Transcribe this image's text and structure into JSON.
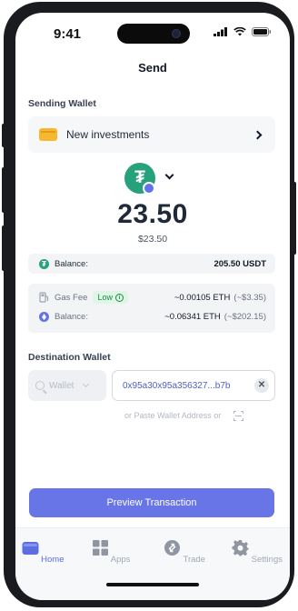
{
  "status_bar": {
    "time": "9:41"
  },
  "header": {
    "title": "Send"
  },
  "sending_wallet": {
    "section_label": "Sending Wallet",
    "wallet_name": "New investments"
  },
  "token": {
    "amount": "23.50",
    "amount_usd": "$23.50",
    "balance_label": "Balance:",
    "balance_value": "205.50 USDT"
  },
  "fees": {
    "gas_fee_label": "Gas Fee",
    "gas_level": "Low",
    "gas_fee_value": "~0.00105 ETH",
    "gas_fee_usd": "(~$3.35)",
    "eth_balance_label": "Balance:",
    "eth_balance_value": "~0.06341 ETH",
    "eth_balance_usd": "(~$202.15)"
  },
  "destination": {
    "section_label": "Destination Wallet",
    "wallet_dropdown_placeholder": "Wallet",
    "address_value": "0x95a30x95a356327...b7b",
    "paste_hint": "or Paste Wallet Address or"
  },
  "actions": {
    "preview_label": "Preview Transaction"
  },
  "tabbar": {
    "items": [
      {
        "label": "Home",
        "icon": "wallet-icon",
        "active": true
      },
      {
        "label": "Apps",
        "icon": "grid-icon",
        "active": false
      },
      {
        "label": "Trade",
        "icon": "trade-icon",
        "active": false
      },
      {
        "label": "Settings",
        "icon": "gear-icon",
        "active": false
      }
    ]
  },
  "colors": {
    "accent": "#6775e6",
    "tether_green": "#26a17b",
    "eth_purple": "#6272ea",
    "low_badge_green": "#1d8a4a",
    "folder_yellow": "#f5b82e"
  }
}
